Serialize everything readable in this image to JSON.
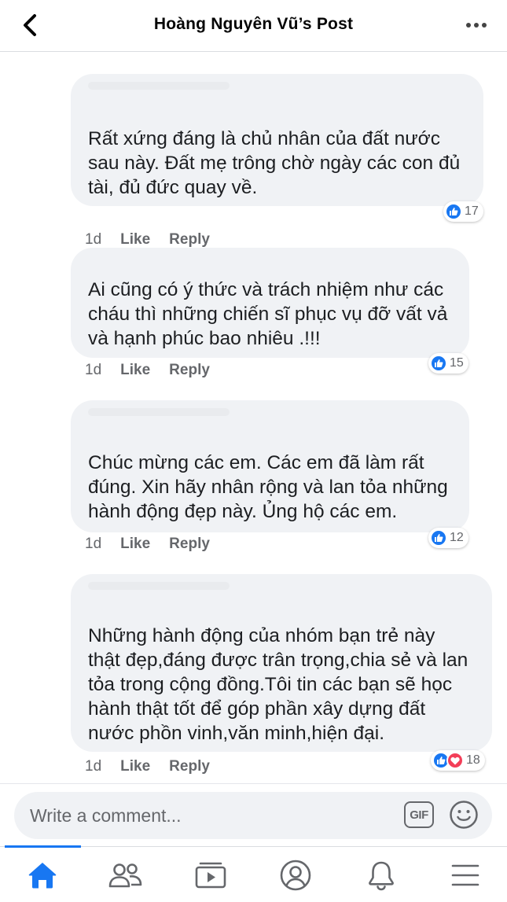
{
  "header": {
    "title": "Hoàng Nguyên Vũ’s Post"
  },
  "comments": [
    {
      "lines": [
        "Rất xứng đáng là chủ nhân của đất nước",
        "sau này. Đất mẹ trông chờ ngày các con đủ",
        "tài, đủ đức quay về."
      ],
      "time": "1d",
      "like_label": "Like",
      "reply_label": "Reply",
      "reactions": [
        "like"
      ],
      "reaction_count": "17"
    },
    {
      "lines": [
        "Ai cũng có ý thức và trách nhiệm như các",
        "cháu thì những chiến sĩ phục vụ đỡ vất vả",
        "và hạnh phúc bao nhiêu .!!!"
      ],
      "time": "1d",
      "like_label": "Like",
      "reply_label": "Reply",
      "reactions": [
        "like"
      ],
      "reaction_count": "15"
    },
    {
      "lines": [
        "Chúc mừng các em. Các em đã làm rất",
        "đúng. Xin hãy nhân rộng và lan tỏa những",
        "hành động đẹp này. Ủng hộ các em."
      ],
      "time": "1d",
      "like_label": "Like",
      "reply_label": "Reply",
      "reactions": [
        "like"
      ],
      "reaction_count": "12"
    },
    {
      "lines": [
        "Những hành động của nhóm bạn trẻ này",
        "thật đẹp,đáng được trân trọng,chia sẻ và lan",
        "tỏa trong cộng đồng.Tôi tin các bạn sẽ học",
        "hành thật tốt để góp phần xây dựng đất",
        "nước phồn vinh,văn minh,hiện đại."
      ],
      "time": "1d",
      "like_label": "Like",
      "reply_label": "Reply",
      "reactions": [
        "like",
        "love"
      ],
      "reaction_count": "18"
    }
  ],
  "composer": {
    "placeholder": "Write a comment...",
    "gif_label": "GIF",
    "emoji_icon": "smiley-icon"
  },
  "tabbar": {
    "tabs": [
      "home-icon",
      "friends-icon",
      "watch-icon",
      "profile-icon",
      "notifications-icon",
      "menu-icon"
    ],
    "active": "home-icon"
  },
  "colors": {
    "accent": "#1877f2",
    "love": "#f33e58",
    "bubble": "#f0f2f5",
    "meta_text": "#65676b"
  }
}
